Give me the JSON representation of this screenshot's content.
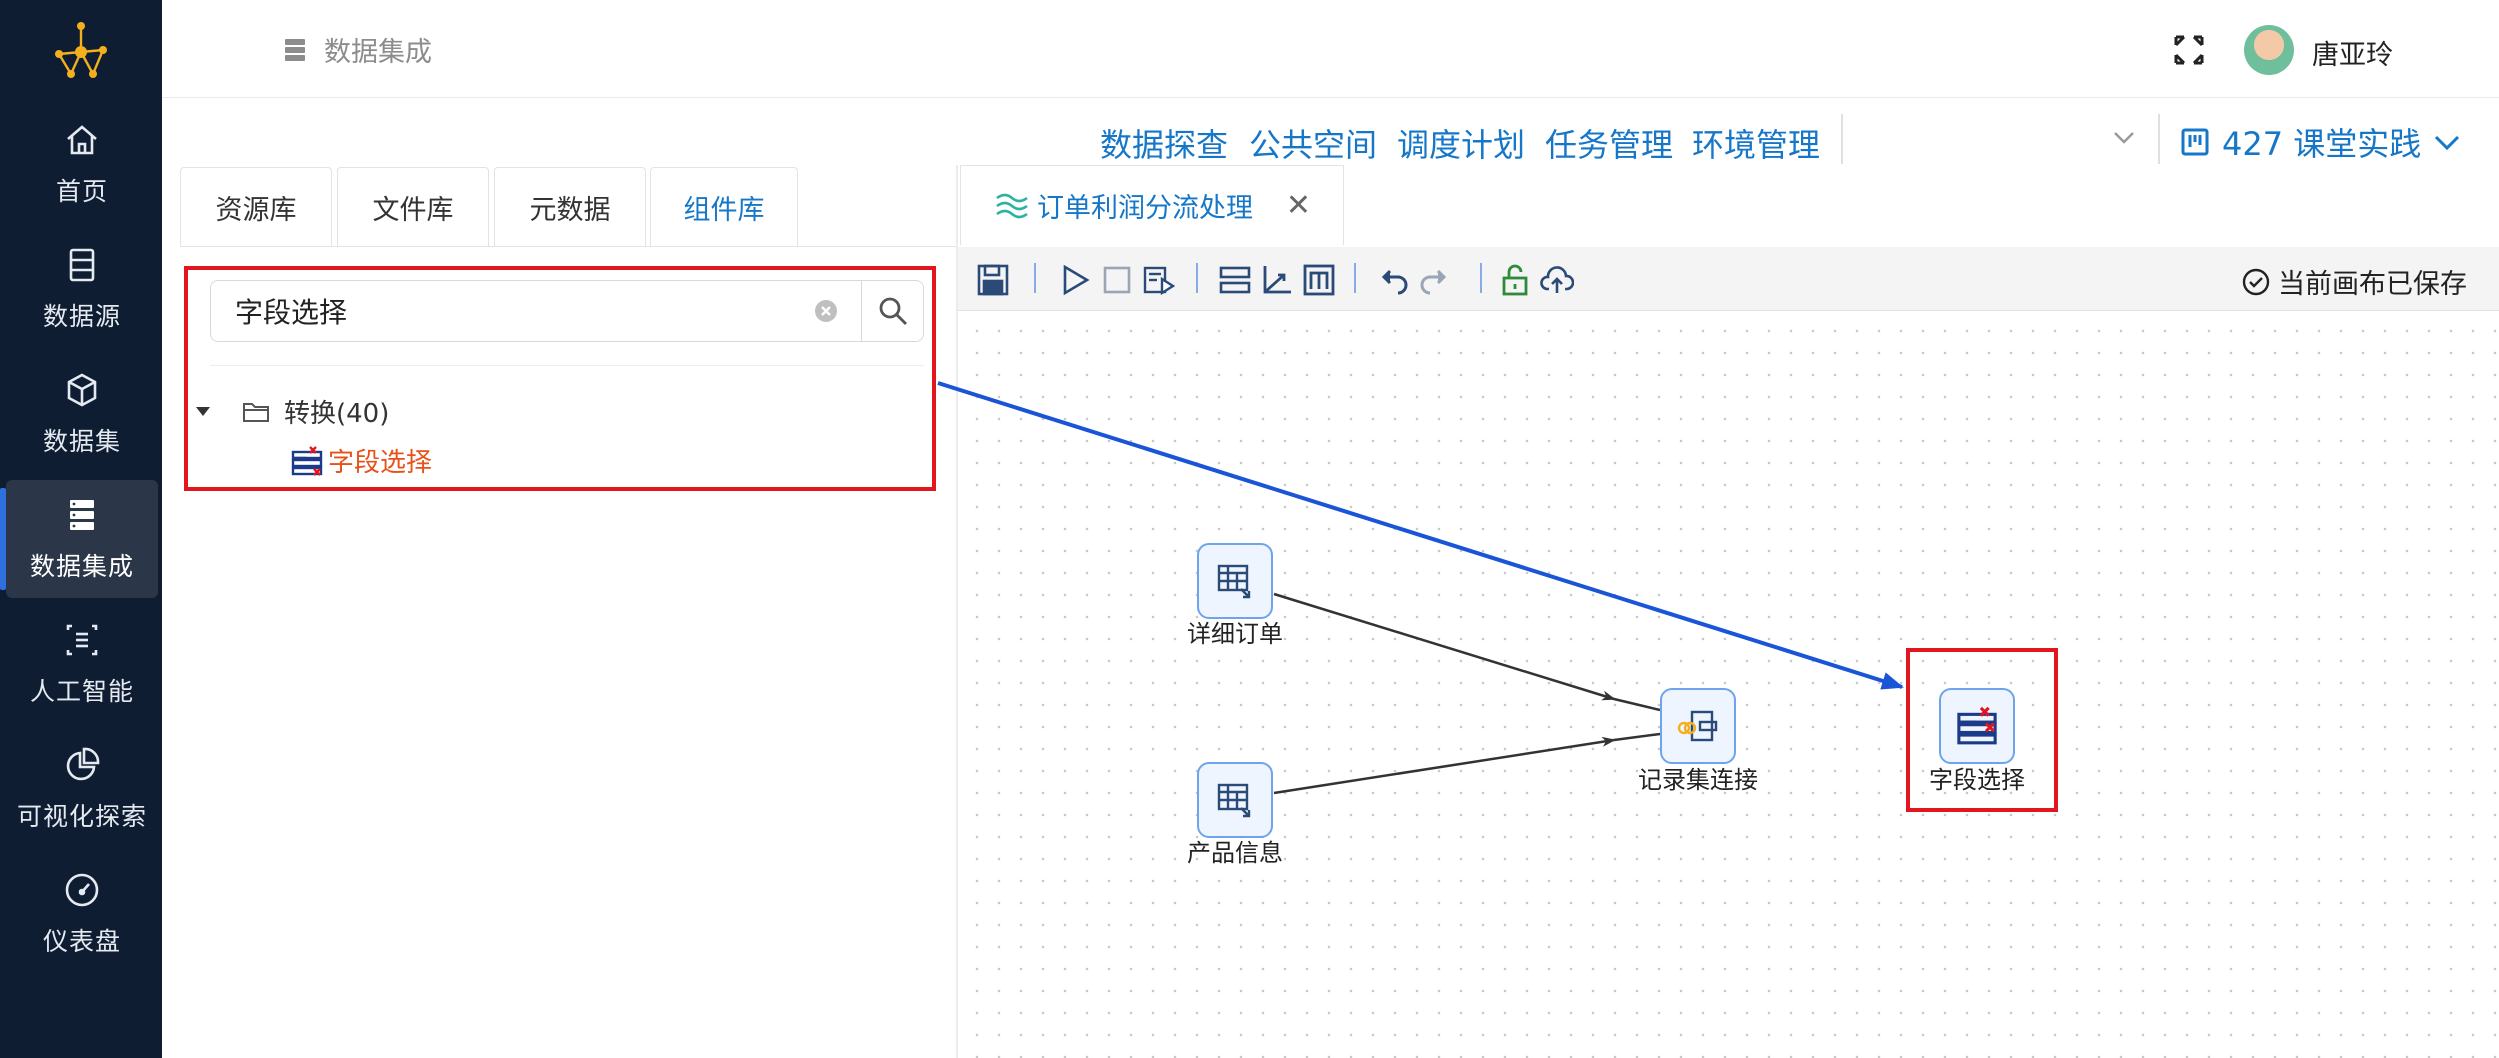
{
  "breadcrumb": {
    "icon": "database-icon",
    "text": "数据集成"
  },
  "user": {
    "name": "唐亚玲"
  },
  "sidebar": {
    "items": [
      {
        "label": "首页",
        "icon": "home-icon"
      },
      {
        "label": "数据源",
        "icon": "database-icon"
      },
      {
        "label": "数据集",
        "icon": "cube-icon"
      },
      {
        "label": "数据集成",
        "icon": "server-stack-icon",
        "active": true
      },
      {
        "label": "人工智能",
        "icon": "ai-icon"
      },
      {
        "label": "可视化探索",
        "icon": "pie-chart-icon"
      },
      {
        "label": "仪表盘",
        "icon": "gauge-icon"
      }
    ]
  },
  "topnav": {
    "items": [
      "数据探查",
      "公共空间",
      "调度计划",
      "任务管理",
      "环境管理"
    ],
    "project": "427 课堂实践"
  },
  "left_tabs": [
    "资源库",
    "文件库",
    "元数据",
    "组件库"
  ],
  "active_left_tab": "组件库",
  "search": {
    "value": "字段选择"
  },
  "tree": {
    "folder": "转换(40)",
    "item": "字段选择"
  },
  "canvas_tab": {
    "title": "订单利润分流处理"
  },
  "status": {
    "saved": "当前画布已保存"
  },
  "nodes": {
    "detail_order": "详细订单",
    "product_info": "产品信息",
    "join": "记录集连接",
    "field_select": "字段选择"
  },
  "colors": {
    "accent": "#1677c9",
    "sidebar_bg": "#0f1d33",
    "highlight": "#e1161f",
    "arrow_blue": "#1a55d8",
    "tree_item": "#e5531a"
  }
}
